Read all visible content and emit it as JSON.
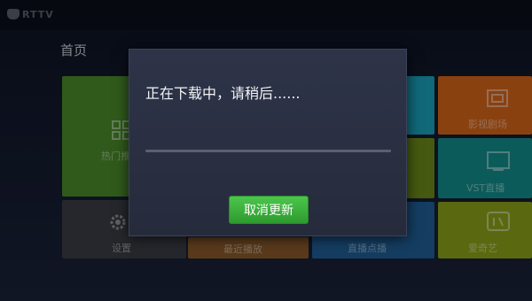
{
  "app": {
    "logo_text": "RTTV"
  },
  "home": {
    "title": "首页"
  },
  "tiles": [
    {
      "name": "tile-green-large",
      "color": "#4a8a2a",
      "label": "热门推荐"
    },
    {
      "name": "tile-settings",
      "color": "#3a3c44",
      "label": "设置"
    },
    {
      "name": "tile-orange-strip",
      "color": "#8a5a2a",
      "label": "最近播放"
    },
    {
      "name": "tile-blue-bottom",
      "color": "#1f5f96",
      "label": "直播点播"
    },
    {
      "name": "tile-cyan-top",
      "color": "#1aa0b8",
      "label": ""
    },
    {
      "name": "tile-yellowgreen",
      "color": "#6a8a1a",
      "label": ""
    },
    {
      "name": "tile-orange-right",
      "color": "#d4641a",
      "label": "影视剧场"
    },
    {
      "name": "tile-teal-right",
      "color": "#138c8c",
      "label": "VST直播"
    },
    {
      "name": "tile-yellowgreen-right",
      "color": "#8aa21a",
      "label": "爱奇艺"
    }
  ],
  "dialog": {
    "message": "正在下载中，请稍后......",
    "progress": 0.0,
    "cancel_label": "取消更新"
  }
}
